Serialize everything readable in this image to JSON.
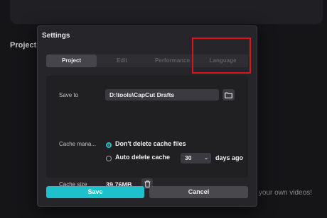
{
  "background": {
    "projects_label": "Projects",
    "tagline": "ng your own videos!"
  },
  "dialog": {
    "title": "Settings",
    "tabs": [
      {
        "label": "Project",
        "active": true
      },
      {
        "label": "Edit",
        "active": false
      },
      {
        "label": "Performance",
        "active": false
      },
      {
        "label": "Language",
        "active": false
      }
    ],
    "save_to": {
      "label": "Save to",
      "path": "D:\\tools\\CapCut Drafts",
      "icon": "folder-icon"
    },
    "cache_management": {
      "label": "Cache mana...",
      "options": [
        {
          "label": "Don't delete cache files",
          "checked": true
        },
        {
          "label": "Auto delete cache",
          "checked": false
        }
      ],
      "days_value": "30",
      "days_suffix": "days ago"
    },
    "cache_size": {
      "label": "Cache size",
      "value": "39.76MB",
      "icon": "trash-icon"
    },
    "buttons": {
      "save": "Save",
      "cancel": "Cancel"
    }
  },
  "colors": {
    "accent": "#1ec0cc",
    "highlight": "#e0131b"
  }
}
